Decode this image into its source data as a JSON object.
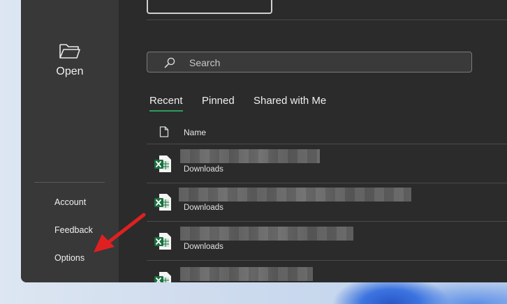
{
  "sidebar": {
    "open_label": "Open",
    "open_icon": "folder-open-icon",
    "links": [
      "Account",
      "Feedback",
      "Options"
    ]
  },
  "main": {
    "search_placeholder": "Search",
    "tabs": [
      {
        "label": "Recent",
        "active": true
      },
      {
        "label": "Pinned",
        "active": false
      },
      {
        "label": "Shared with Me",
        "active": false
      }
    ],
    "column_header": "Name",
    "files": [
      {
        "name": "",
        "location": "Downloads",
        "icon": "excel-file-icon"
      },
      {
        "name": "",
        "location": "Downloads",
        "icon": "excel-file-icon"
      },
      {
        "name": "",
        "location": "Downloads",
        "icon": "excel-file-icon"
      },
      {
        "name": "",
        "location": "",
        "icon": "excel-file-icon"
      }
    ]
  },
  "colors": {
    "accent": "#2e9d5e",
    "annotation_arrow": "#e02020",
    "excel_green": "#1d6f42"
  }
}
